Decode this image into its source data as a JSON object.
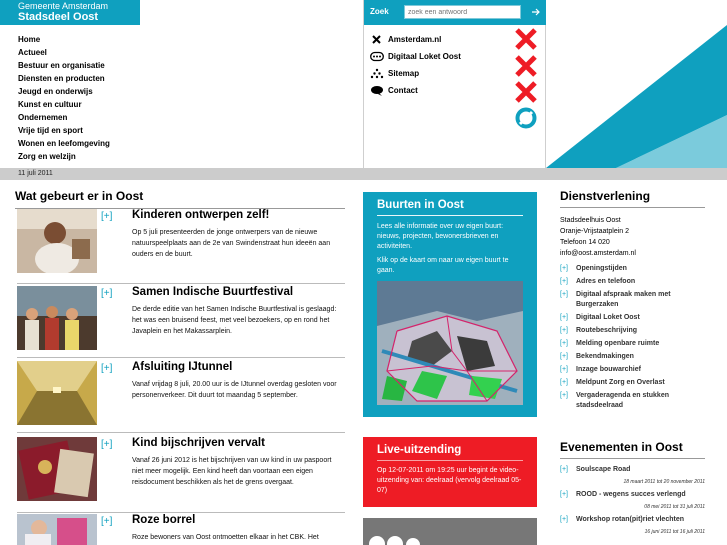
{
  "header": {
    "brand_line1": "Gemeente Amsterdam",
    "brand_line2": "Stadsdeel Oost",
    "search_label": "Zoek",
    "search_placeholder": "zoek een antwoord",
    "search_go_icon": "arrow-right-icon",
    "accent_color": "#0fa0bf"
  },
  "mainnav": [
    "Home",
    "Actueel",
    "Bestuur en organisatie",
    "Diensten en producten",
    "Jeugd en onderwijs",
    "Kunst en cultuur",
    "Ondernemen",
    "Vrije tijd en sport",
    "Wonen en leefomgeving",
    "Zorg en welzijn"
  ],
  "service_links": [
    {
      "label": "Amsterdam.nl",
      "icon": "x-icon"
    },
    {
      "label": "Digitaal Loket Oost",
      "icon": "dots-pill-icon"
    },
    {
      "label": "Sitemap",
      "icon": "sitemap-icon"
    },
    {
      "label": "Contact",
      "icon": "speech-bubble-icon"
    }
  ],
  "date": "11 juli 2011",
  "news": {
    "heading": "Wat gebeurt er in Oost",
    "plus": "[+]",
    "items": [
      {
        "title": "Kinderen ontwerpen zelf!",
        "body": "Op 5 juli presenteerden de jonge ontwerpers van de nieuwe natuurspeelplaats aan de 2e van Swindenstraat hun ideeën aan ouders en de buurt."
      },
      {
        "title": "Samen Indische Buurtfestival",
        "body": "De derde editie van het Samen Indische Buurtfestival is geslaagd: het was een bruisend feest, met veel bezoekers, op en rond het Javaplein en het Makassarplein."
      },
      {
        "title": "Afsluiting IJtunnel",
        "body": "Vanaf vrijdag 8 juli, 20.00 uur is de IJtunnel overdag gesloten voor personenverkeer. Dit duurt tot maandag 5 september."
      },
      {
        "title": "Kind bijschrijven vervalt",
        "body": "Vanaf 26 juni 2012 is het bijschrijven van uw kind in uw paspoort niet meer mogelijk. Een kind heeft dan voortaan een eigen reisdocument beschikken als het de grens overgaat."
      },
      {
        "title": "Roze borrel",
        "body": "Roze bewoners van Oost ontmoetten elkaar in het CBK. Het"
      }
    ]
  },
  "buurten": {
    "title": "Buurten in Oost",
    "text1": "Lees alle informatie over uw eigen buurt: nieuws, projecten, bewonersbrieven en activiteiten.",
    "text2": "Klik op de kaart om naar uw eigen buurt te gaan."
  },
  "live": {
    "title": "Live-uitzending",
    "text": "Op 12-07-2011 om 19:25 uur begint de video-uitzending van: deelraad (vervolg deelraad 05-07)"
  },
  "dienstverlening": {
    "heading": "Dienstverlening",
    "address": [
      "Stadsdeelhuis Oost",
      "Oranje-Vrijstaatplein 2",
      "Telefoon 14 020",
      "info@oost.amsterdam.nl"
    ],
    "bullet": "[+]",
    "items": [
      "Openingstijden",
      "Adres en telefoon",
      "Digitaal afspraak maken met Burgerzaken",
      "Digitaal Loket Oost",
      "Routebeschrijving",
      "Melding openbare ruimte",
      "Bekendmakingen",
      "Inzage bouwarchief",
      "Meldpunt Zorg en Overlast",
      "Vergaderagenda en stukken stadsdeelraad"
    ]
  },
  "evenementen": {
    "heading": "Evenementen in Oost",
    "bullet": "[+]",
    "items": [
      {
        "title": "Soulscape Road",
        "dates": "18 maart 2011 tot 20 november 2011"
      },
      {
        "title": "ROOD - wegens succes verlengd",
        "dates": "08 mei 2011 tot 31 juli 2011"
      },
      {
        "title": "Workshop rotan(pit)riet vlechten",
        "dates": "16 juni 2011 tot 16 juli 2011"
      }
    ]
  }
}
